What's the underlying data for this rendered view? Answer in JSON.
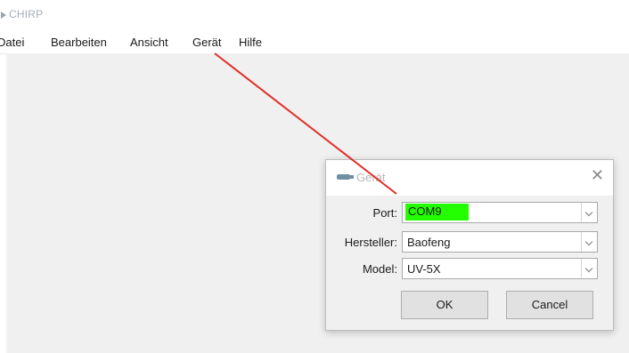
{
  "app": {
    "title": "CHIRP"
  },
  "menu": {
    "items": [
      {
        "label": "Datei"
      },
      {
        "label": "Bearbeiten"
      },
      {
        "label": "Ansicht"
      },
      {
        "label": "Gerät"
      },
      {
        "label": "Hilfe"
      }
    ]
  },
  "dialog": {
    "title": "Gerät",
    "fields": {
      "port": {
        "label": "Port:",
        "value": "COM9"
      },
      "vendor": {
        "label": "Hersteller:",
        "value": "Baofeng"
      },
      "model": {
        "label": "Model:",
        "value": "UV-5X"
      }
    },
    "ok_label": "OK",
    "cancel_label": "Cancel"
  },
  "colors": {
    "highlight": "#24ff00",
    "annotation_line": "#e0302a"
  }
}
